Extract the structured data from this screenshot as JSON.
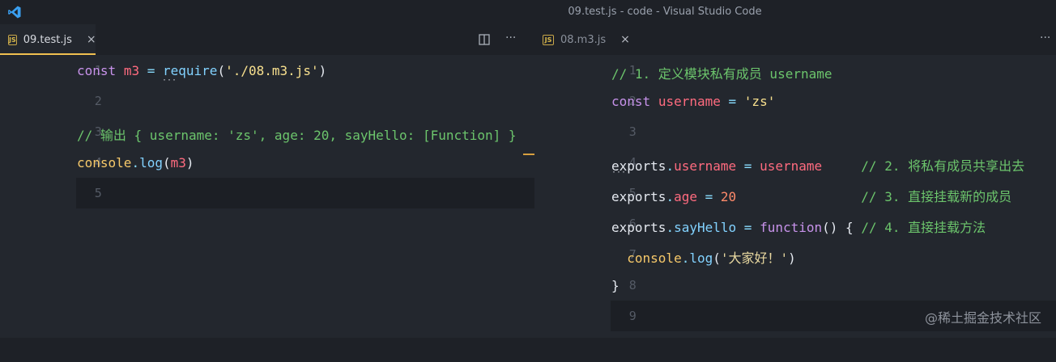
{
  "window": {
    "title": "09.test.js - code - Visual Studio Code"
  },
  "left_editor": {
    "tab": {
      "label": "09.test.js",
      "icon": "JS",
      "close": "×"
    },
    "lines": [
      {
        "num": "1",
        "text": "const m3 = require('./08.m3.js')"
      },
      {
        "num": "2",
        "text": ""
      },
      {
        "num": "3",
        "text": "// 输出 { username: 'zs', age: 20, sayHello: [Function] }"
      },
      {
        "num": "4",
        "text": "console.log(m3)"
      },
      {
        "num": "5",
        "text": ""
      }
    ]
  },
  "right_editor": {
    "tab": {
      "label": "08.m3.js",
      "icon": "JS",
      "close": "×"
    },
    "lines": [
      {
        "num": "1",
        "text": "// 1. 定义模块私有成员 username"
      },
      {
        "num": "2",
        "text": "const username = 'zs'"
      },
      {
        "num": "3",
        "text": ""
      },
      {
        "num": "4",
        "text": "exports.username = username     // 2. 将私有成员共享出去"
      },
      {
        "num": "5",
        "text": "exports.age = 20                // 3. 直接挂载新的成员"
      },
      {
        "num": "6",
        "text": "exports.sayHello = function() { // 4. 直接挂载方法"
      },
      {
        "num": "7",
        "text": "  console.log('大家好！')"
      },
      {
        "num": "8",
        "text": "}"
      },
      {
        "num": "9",
        "text": ""
      }
    ]
  },
  "watermark": "@稀土掘金技术社区",
  "colors": {
    "background": "#1e2127",
    "editor": "#23272e",
    "accent": "#f0c050"
  }
}
